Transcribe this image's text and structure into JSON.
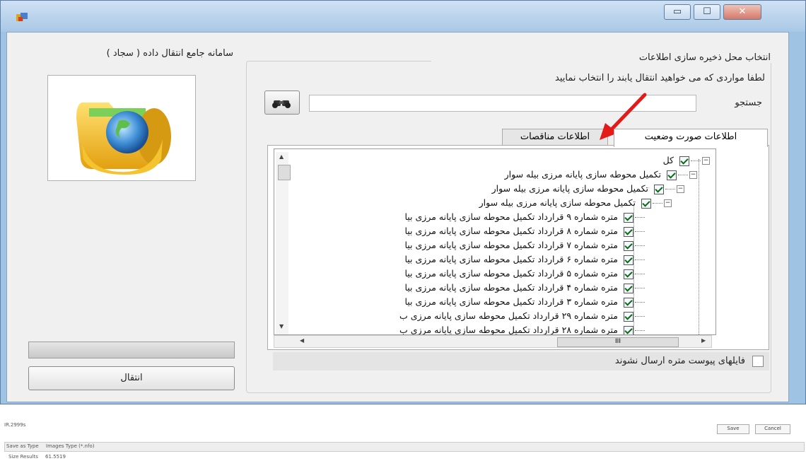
{
  "window": {
    "controls": {
      "minimize": "▭",
      "maximize": "☐",
      "close": "✕"
    }
  },
  "left_panel": {
    "system_title": "سامانه جامع انتقال داده ( سجاد )",
    "transfer_button": "انتقال"
  },
  "right_panel": {
    "group_title": "انتخاب محل ذخیره سازی اطلاعات",
    "instruction": "لطفا مواردی که می خواهید انتقال یابند را انتخاب نمایید",
    "search_label": "جستجو",
    "search_value": "",
    "tabs": [
      {
        "label": "اطلاعات صورت وضعیت",
        "active": true
      },
      {
        "label": "اطلاعات مناقصات",
        "active": false
      }
    ],
    "tree": [
      {
        "label": "کل",
        "level": 0,
        "expandable": true
      },
      {
        "label": "تکمیل محوطه سازی پایانه مرزی بیله سوار",
        "level": 1,
        "expandable": true
      },
      {
        "label": "تکمیل محوطه سازی پایانه مرزی بیله سوار",
        "level": 2,
        "expandable": true
      },
      {
        "label": "تکمیل محوطه سازی پایانه مرزی بیله سوار",
        "level": 3,
        "expandable": true
      },
      {
        "label": "متره شماره ۹ قرارداد تکمیل محوطه سازی پایانه مرزی بیا",
        "level": 4,
        "expandable": false
      },
      {
        "label": "متره شماره ۸ قرارداد تکمیل محوطه سازی پایانه مرزی بیا",
        "level": 4,
        "expandable": false
      },
      {
        "label": "متره شماره ۷ قرارداد تکمیل محوطه سازی پایانه مرزی بیا",
        "level": 4,
        "expandable": false
      },
      {
        "label": "متره شماره ۶ قرارداد تکمیل محوطه سازی پایانه مرزی بیا",
        "level": 4,
        "expandable": false
      },
      {
        "label": "متره شماره ۵ قرارداد تکمیل محوطه سازی پایانه مرزی بیا",
        "level": 4,
        "expandable": false
      },
      {
        "label": "متره شماره ۴ قرارداد تکمیل محوطه سازی پایانه مرزی بیا",
        "level": 4,
        "expandable": false
      },
      {
        "label": "متره شماره ۳ قرارداد تکمیل محوطه سازی پایانه مرزی بیا",
        "level": 4,
        "expandable": false
      },
      {
        "label": "متره شماره ۲۹ قرارداد تکمیل محوطه سازی پایانه مرزی ب",
        "level": 4,
        "expandable": false
      },
      {
        "label": "متره شماره ۲۸ قرارداد تکمیل محوطه سازی پایانه مرزی ب",
        "level": 4,
        "expandable": false
      }
    ],
    "hscroll_label": "III",
    "exclude_attachments_label": "فایلهای پیوست متره ارسال نشوند"
  },
  "bottom_snippet": {
    "left_top": "IR.2999s",
    "buttons": [
      "Save",
      "Cancel"
    ],
    "row1_label": "Save as Type",
    "row1_value": "Images Type (*.nfo)",
    "row2_label": "Size Results",
    "row2_value": "61.5519"
  },
  "colors": {
    "title_bar": "#a9c8e6",
    "client_bg": "#f0f0f0",
    "annotation_arrow": "#e21a1a"
  }
}
